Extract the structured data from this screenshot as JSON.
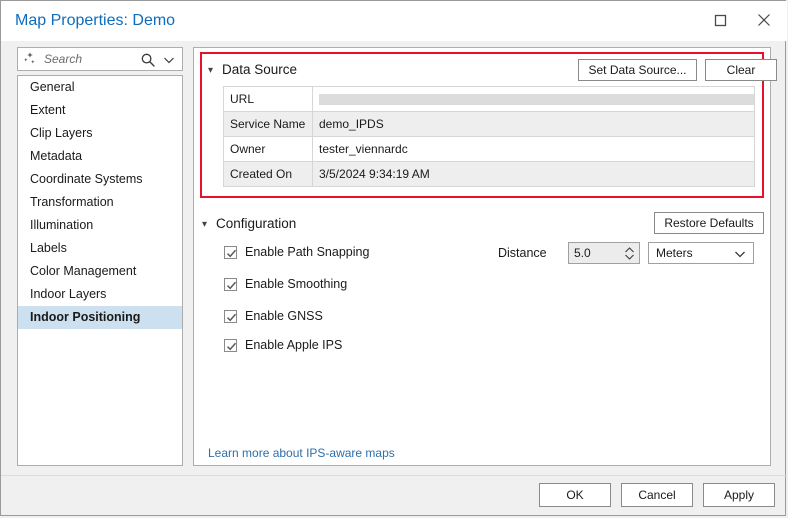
{
  "window": {
    "title": "Map Properties: Demo",
    "controls": [
      {
        "name": "maximize-button",
        "icon": "maximize-icon"
      },
      {
        "name": "close-button",
        "icon": "close-icon"
      }
    ],
    "title_color": "#0f6cbd"
  },
  "search": {
    "placeholder": "Search",
    "sparkle_icon": "sparkle-icon",
    "magnifier_icon": "search-icon",
    "chevron_icon": "chevron-down-icon"
  },
  "sidebar": {
    "items": [
      {
        "label": "General",
        "selected": false
      },
      {
        "label": "Extent",
        "selected": false
      },
      {
        "label": "Clip Layers",
        "selected": false
      },
      {
        "label": "Metadata",
        "selected": false
      },
      {
        "label": "Coordinate Systems",
        "selected": false
      },
      {
        "label": "Transformation",
        "selected": false
      },
      {
        "label": "Illumination",
        "selected": false
      },
      {
        "label": "Labels",
        "selected": false
      },
      {
        "label": "Color Management",
        "selected": false
      },
      {
        "label": "Indoor Layers",
        "selected": false
      },
      {
        "label": "Indoor Positioning",
        "selected": true
      }
    ],
    "selection_color": "#cce0f0"
  },
  "data_source": {
    "header": "Data Source",
    "caret": "▾",
    "highlight_color": "#e8112d",
    "set_data_source_label": "Set Data Source...",
    "clear_label": "Clear",
    "rows": [
      {
        "label": "URL",
        "value": "",
        "redacted": true
      },
      {
        "label": "Service Name",
        "value": "demo_IPDS",
        "redacted": false
      },
      {
        "label": "Owner",
        "value": "tester_viennardc",
        "redacted": false
      },
      {
        "label": "Created On",
        "value": "3/5/2024 9:34:19 AM",
        "redacted": false
      }
    ]
  },
  "configuration": {
    "header": "Configuration",
    "caret": "▾",
    "restore_defaults_label": "Restore Defaults",
    "checkboxes": [
      {
        "label": "Enable Path Snapping",
        "checked": true
      },
      {
        "label": "Enable Smoothing",
        "checked": true
      },
      {
        "label": "Enable GNSS",
        "checked": true
      },
      {
        "label": "Enable Apple IPS",
        "checked": true
      }
    ],
    "distance": {
      "label": "Distance",
      "value": "5.0",
      "units": "Meters",
      "units_chevron": "chevron-down-icon",
      "spinner_icon": "spinner-arrows-icon"
    }
  },
  "link": {
    "learn_more": "Learn more about IPS-aware maps"
  },
  "footer": {
    "ok_label": "OK",
    "cancel_label": "Cancel",
    "apply_label": "Apply"
  }
}
